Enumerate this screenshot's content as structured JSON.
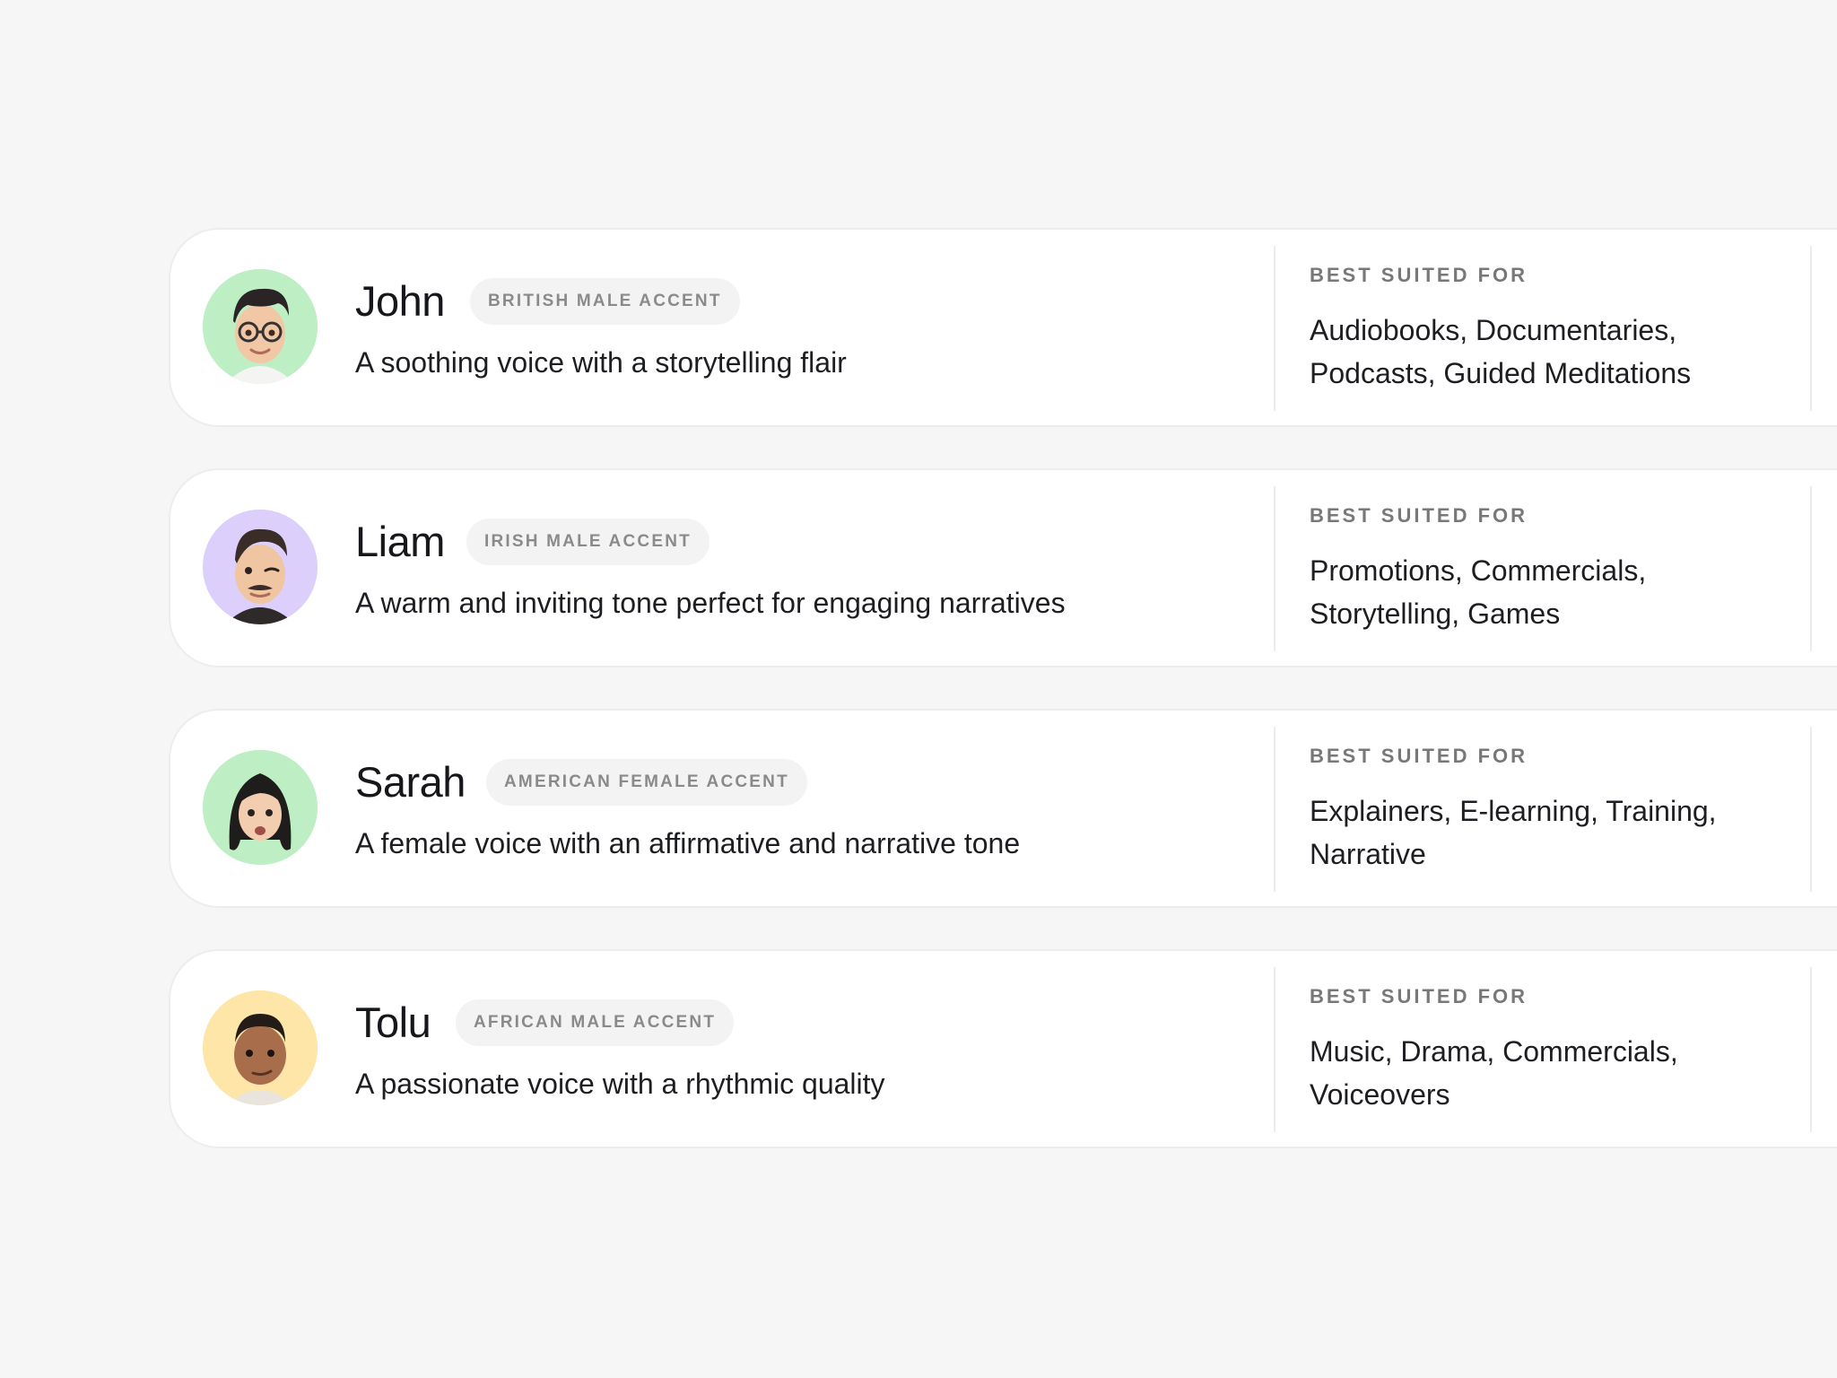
{
  "voices": [
    {
      "name": "John",
      "accent": "BRITISH MALE ACCENT",
      "description": "A soothing voice with a storytelling flair",
      "suited_label": "BEST SUITED FOR",
      "suited_for": "Audiobooks, Documentaries, Podcasts, Guided Meditations",
      "avatar_bg": "#bdeec4",
      "avatar_icon": "man-with-glasses-avatar-icon"
    },
    {
      "name": "Liam",
      "accent": "IRISH MALE ACCENT",
      "description": "A warm and inviting tone perfect for engaging narratives",
      "suited_label": "BEST SUITED FOR",
      "suited_for": "Promotions, Commercials, Storytelling, Games",
      "avatar_bg": "#dccffb",
      "avatar_icon": "winking-man-with-mustache-avatar-icon"
    },
    {
      "name": "Sarah",
      "accent": "AMERICAN FEMALE ACCENT",
      "description": "A female voice with an affirmative and narrative tone",
      "suited_label": "BEST SUITED FOR",
      "suited_for": "Explainers, E-learning, Training, Narrative",
      "avatar_bg": "#bdeec4",
      "avatar_icon": "woman-with-dark-hair-avatar-icon"
    },
    {
      "name": "Tolu",
      "accent": "AFRICAN MALE ACCENT",
      "description": "A passionate voice with a rhythmic quality",
      "suited_label": "BEST SUITED FOR",
      "suited_for": "Music, Drama, Commercials, Voiceovers",
      "avatar_bg": "#fde6a8",
      "avatar_icon": "man-smirking-avatar-icon"
    }
  ]
}
